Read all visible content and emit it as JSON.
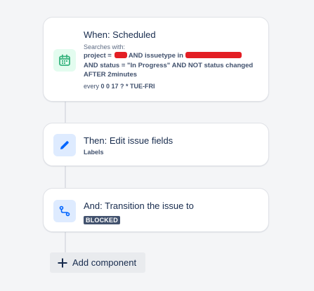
{
  "trigger": {
    "title": "When: Scheduled",
    "searches_label": "Searches with:",
    "jql_line1_part1": "project =",
    "jql_line1_part2": "AND issuetype in",
    "jql_line2": "AND status = \"In Progress\" AND NOT status changed",
    "jql_line3": "AFTER 2minutes",
    "schedule_prefix": "every",
    "schedule_value": "0 0 17 ? * TUE-FRI",
    "icon": "calendar-icon"
  },
  "action": {
    "title": "Then: Edit issue fields",
    "detail": "Labels",
    "icon": "pencil-icon"
  },
  "transition": {
    "title": "And: Transition the issue to",
    "status": "BLOCKED",
    "icon": "transition-icon"
  },
  "add_component": {
    "label": "Add component",
    "icon": "plus-icon"
  },
  "colors": {
    "background": "#f4f5f7",
    "trigger_icon": "#36b37e",
    "action_icon": "#0065ff",
    "lozenge": "#42526e",
    "redaction": "#e31e24"
  }
}
